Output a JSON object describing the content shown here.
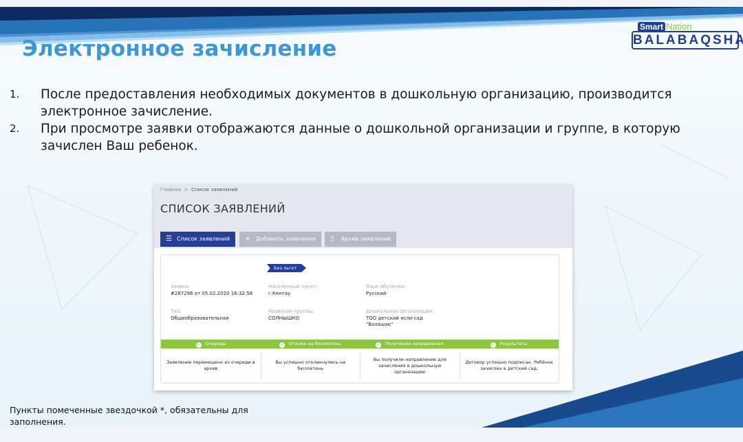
{
  "slide": {
    "title": "Электронное зачисление",
    "steps": [
      {
        "num": "1.",
        "text": "После предоставления необходимых документов в дошкольную организацию, производится электронное зачисление."
      },
      {
        "num": "2.",
        "text": "При просмотре заявки отображаются данные о дошкольной организации и группе, в которую зачислен Ваш ребенок."
      }
    ],
    "footnote": "Пункты помеченные звездочкой *, обязательны для заполнения.",
    "logo": {
      "smart": "Smart",
      "nation": "Nation",
      "name": "BALABAQSHA"
    }
  },
  "app": {
    "breadcrumb": {
      "home": "Главная",
      "separator": ">",
      "current": "Список заявлений"
    },
    "page_title": "СПИСОК ЗАЯВЛЕНИЙ",
    "tabs": [
      {
        "label": "Список заявлений",
        "icon": "list-icon",
        "active": true
      },
      {
        "label": "Добавить заявление",
        "icon": "plus-icon",
        "active": false
      },
      {
        "label": "Архив заявлений",
        "icon": "document-icon",
        "active": false
      }
    ],
    "application": {
      "badge": "Без льгот",
      "fields": [
        {
          "label": "Заявка:",
          "value": "#287296 от 05.02.2020 16:32:58"
        },
        {
          "label": "Населенный пункт:",
          "value": "г.Кентау"
        },
        {
          "label": "Язык обучения:",
          "value": "Русский"
        },
        {
          "label": "Тип:",
          "value": "Общеобразовательная"
        },
        {
          "label": "Название группы:",
          "value": "СОЛНЫШКО"
        },
        {
          "label": "Дошкольная организация:",
          "value": "ТОО детский ясли-сад \"Болашақ\""
        }
      ],
      "progress": [
        {
          "label": "Очередь",
          "status": "Заявление перемещено из очереди в архив"
        },
        {
          "label": "Отклик на бюллетень",
          "status": "Вы успешно откликнулись на бюллетень"
        },
        {
          "label": "Получение направления",
          "status": "Вы получили направление для зачисления в дошкольную организацию"
        },
        {
          "label": "Результаты",
          "status": "Договор успешно подписан. Ребёнок зачислен в детский сад."
        }
      ]
    }
  },
  "colors": {
    "title": "#3d97d4",
    "accent": "#253e97",
    "progress": "#8cc63f",
    "tab_inactive": "#b4b8c7"
  }
}
